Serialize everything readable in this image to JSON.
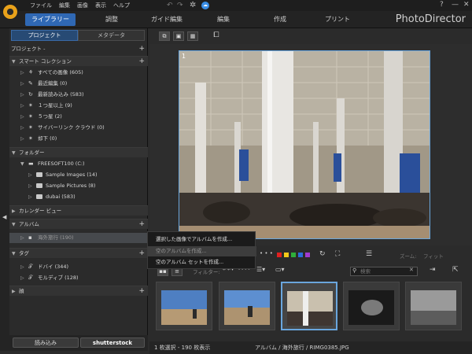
{
  "menu": [
    "ファイル",
    "編集",
    "画像",
    "表示",
    "ヘルプ"
  ],
  "window_controls": [
    "?",
    "—",
    "✕"
  ],
  "modules": [
    "ライブラリー",
    "調整",
    "ガイド編集",
    "編集",
    "作成",
    "プリント"
  ],
  "brand": "PhotoDirector",
  "panel_tabs": [
    "プロジェクト",
    "メタデータ"
  ],
  "tree": {
    "project": "プロジェクト -",
    "smart": "スマート コレクション",
    "smart_items": [
      {
        "label": "すべての画像 (605)"
      },
      {
        "label": "最近編集 (0)"
      },
      {
        "label": "最新読み込み (583)"
      },
      {
        "label": "１つ星以上 (9)"
      },
      {
        "label": "５つ星 (2)"
      },
      {
        "label": "サイバーリンク クラウド (0)"
      },
      {
        "label": "却下 (0)"
      }
    ],
    "folders": "フォルダー",
    "drive": "FREESOFT100 (C:)",
    "folder_items": [
      "Sample Images (14)",
      "Sample Pictures (8)",
      "dubai (583)"
    ],
    "calendar": "カレンダー ビュー",
    "album": "アルバム",
    "album_item": "海外旅行 (190)",
    "tags": "タグ",
    "tag_items": [
      "ドバイ (344)",
      "モルディブ (128)"
    ],
    "faces": "顔"
  },
  "buttons": {
    "import": "読み込み",
    "shutterstock": "shutterstock"
  },
  "viewer": {
    "photo_index": "1"
  },
  "context_menu": [
    "選択した画像でアルバムを作成...",
    "空のアルバムを作成...",
    "空のアルバム セットを作成..."
  ],
  "edit_toolbar": {
    "zoom_label": "ズーム:",
    "zoom_value": "フィット"
  },
  "filmbar": {
    "filter_label": "フィルター:",
    "search_placeholder": "検索"
  },
  "colors": {
    "accent": "#2f68b4",
    "selection": "#6aa6dd",
    "labels": [
      "#e02020",
      "#f2c81a",
      "#2fae3a",
      "#2a6cd9",
      "#a03ad0"
    ]
  },
  "status": {
    "left": "1 枚選択 - 190 枚表示",
    "right": "アルバム / 海外旅行 / RIMG0385.JPG"
  }
}
